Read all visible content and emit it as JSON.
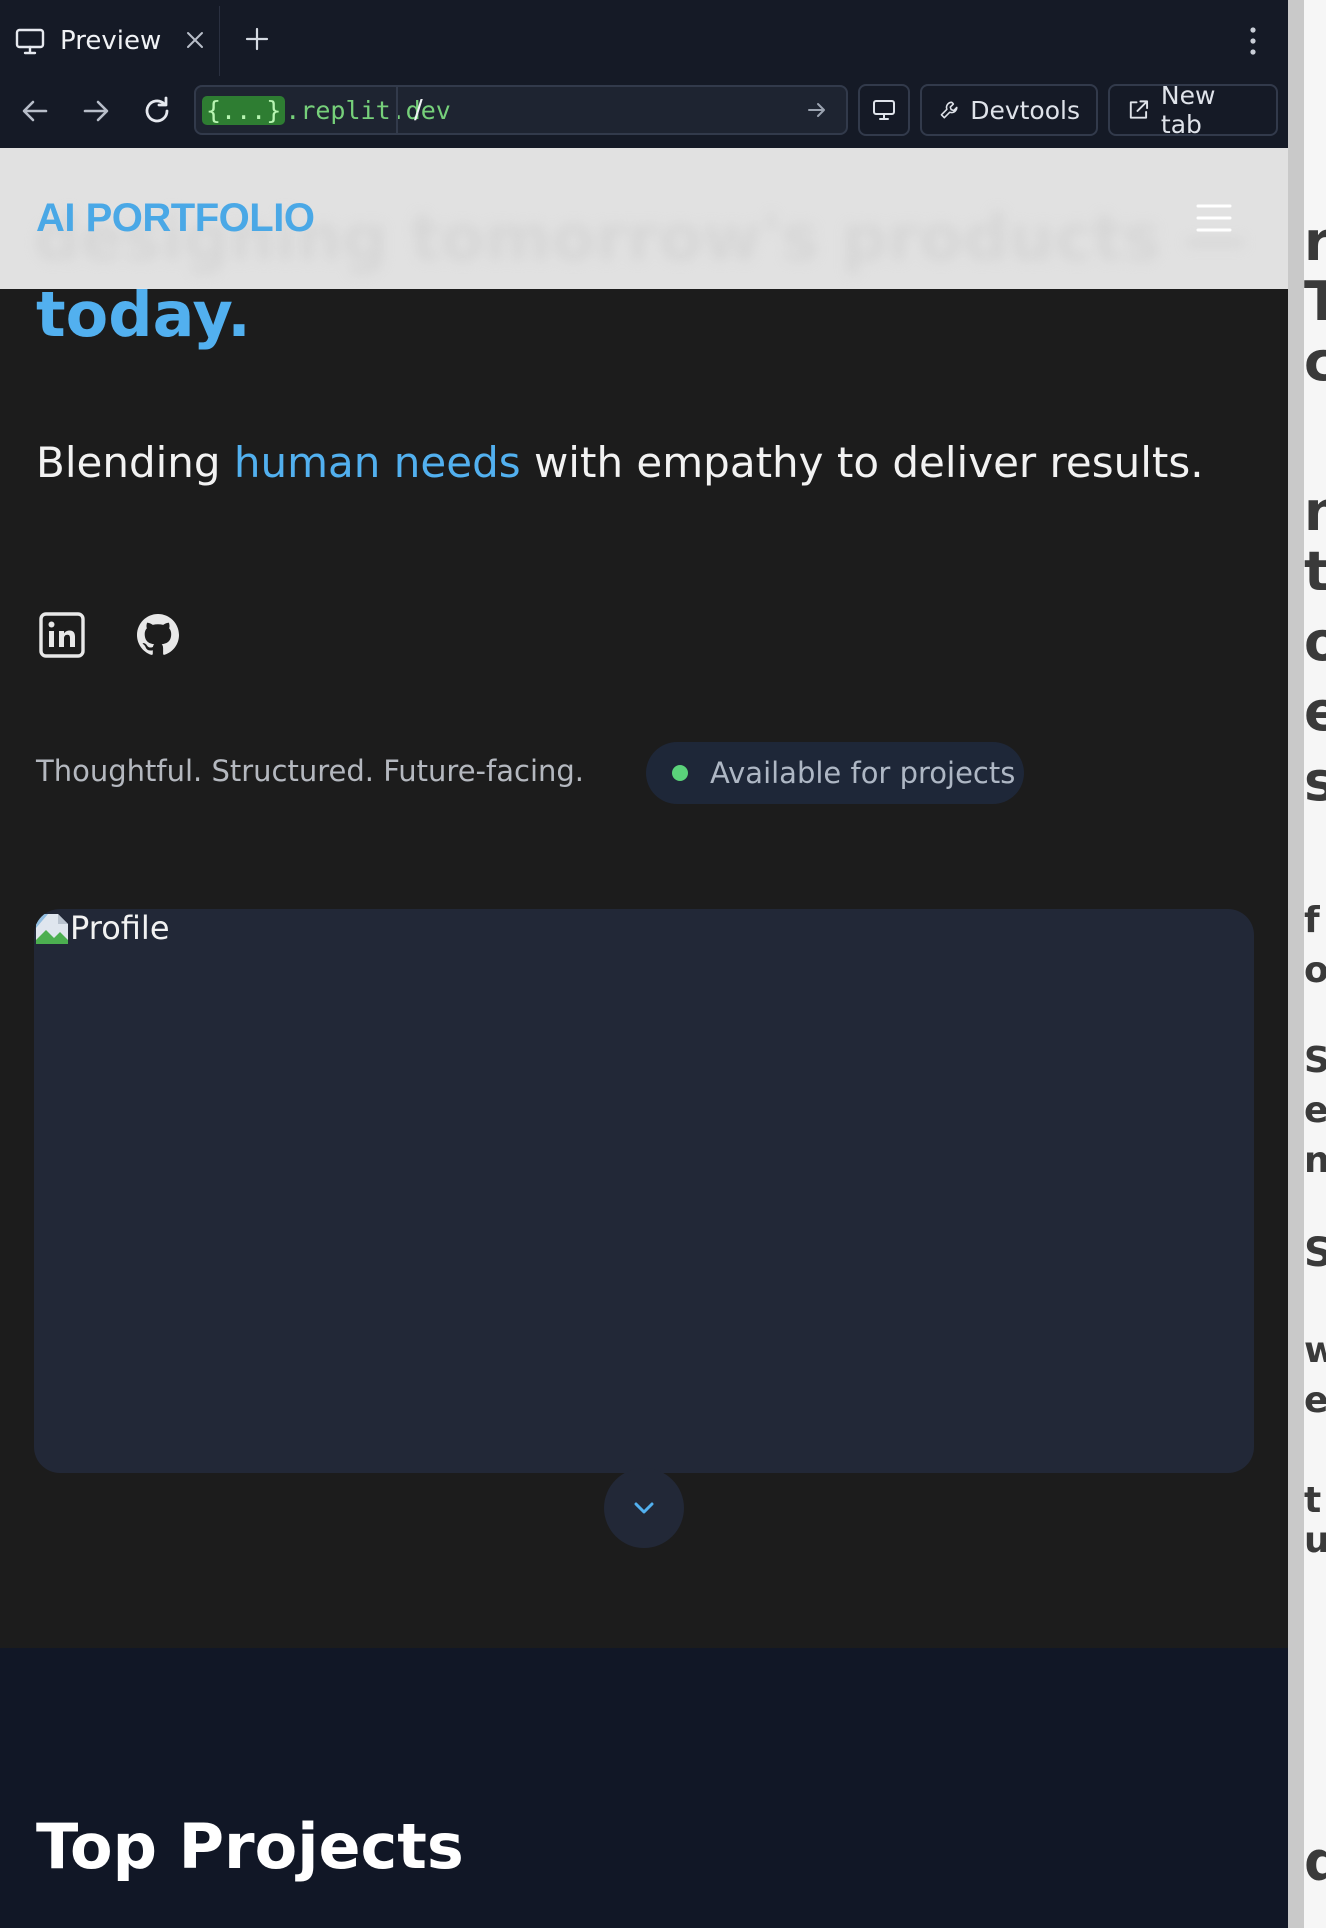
{
  "browser": {
    "tab_title": "Preview",
    "url_host_braces": "{...}",
    "url_host_domain": ".replit.dev",
    "url_path": "/",
    "devtools_label": "Devtools",
    "new_tab_label": "New tab"
  },
  "nav": {
    "logo": "AI PORTFOLIO",
    "ghost_heading": "designing tomorrow's products —"
  },
  "hero": {
    "heading_end": "today.",
    "tagline_pre": "Blending ",
    "tagline_highlight": "human needs",
    "tagline_post": " with empathy to deliver results.",
    "motto": "Thoughtful. Structured. Future-facing.",
    "status": "Available for projects",
    "profile_alt": "Profile"
  },
  "social": [
    "linkedin-icon",
    "github-icon"
  ],
  "projects": {
    "title": "Top Projects"
  },
  "colors": {
    "accent": "#52b0ef",
    "status_green": "#5ad27a",
    "card_bg": "#222837",
    "page_bg": "#1c1c1c"
  }
}
